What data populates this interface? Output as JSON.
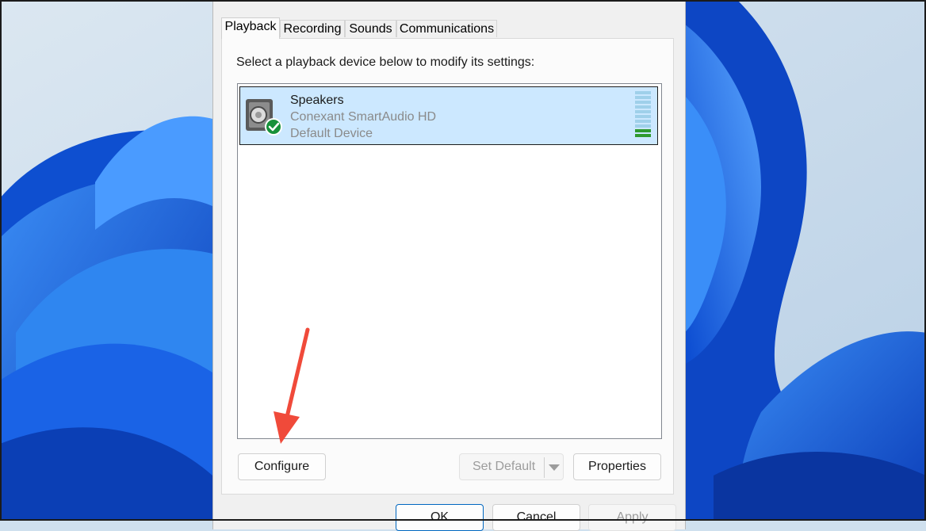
{
  "tabs": [
    {
      "label": "Playback",
      "active": true
    },
    {
      "label": "Recording",
      "active": false
    },
    {
      "label": "Sounds",
      "active": false
    },
    {
      "label": "Communications",
      "active": false
    }
  ],
  "instruction": "Select a playback device below to modify its settings:",
  "devices": [
    {
      "name": "Speakers",
      "driver": "Conexant SmartAudio HD",
      "status": "Default Device",
      "icon": "speaker-icon",
      "status_icon": "green-check-icon",
      "selected": true,
      "level_fraction": 0.1
    }
  ],
  "buttons": {
    "configure": "Configure",
    "set_default": "Set Default",
    "properties": "Properties",
    "ok": "OK",
    "cancel": "Cancel",
    "apply": "Apply"
  },
  "colors": {
    "selection": "#cce8ff",
    "annotation_arrow": "#f04a3a",
    "wallpaper_blue": "#1565e0"
  }
}
